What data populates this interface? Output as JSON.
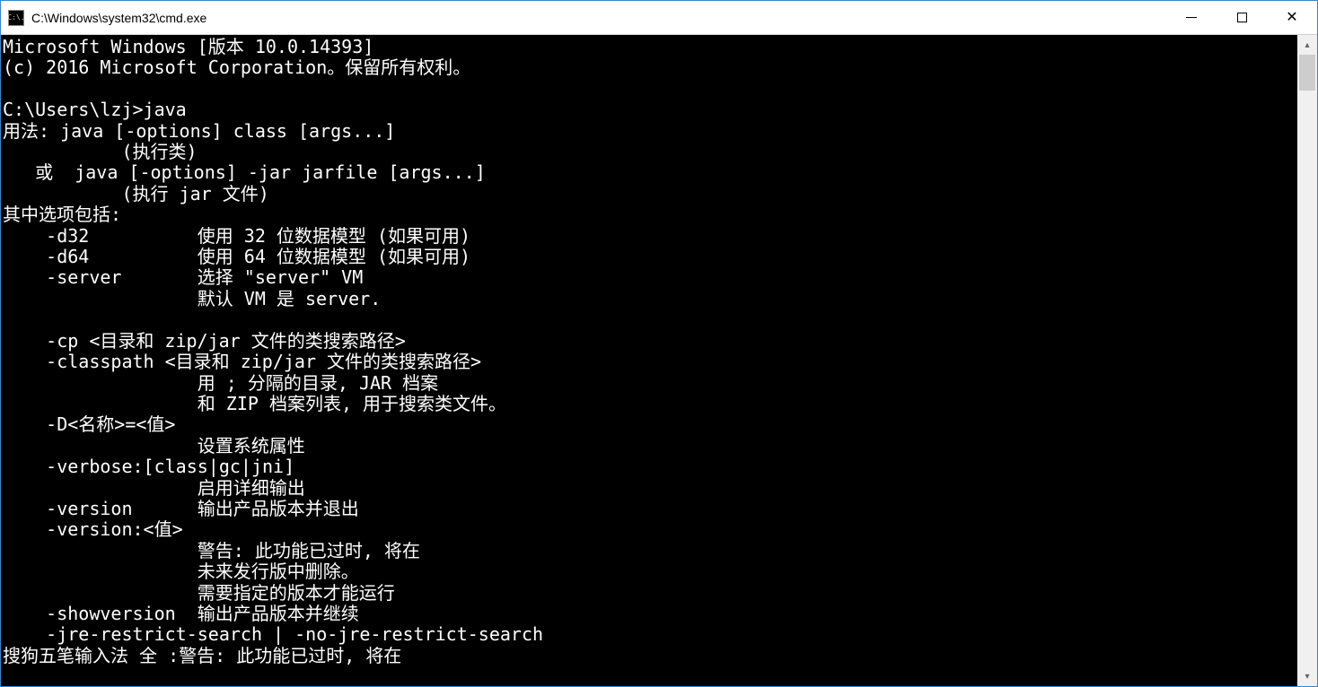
{
  "window": {
    "title": "C:\\Windows\\system32\\cmd.exe",
    "icon_label": "C:\\."
  },
  "terminal": {
    "lines": [
      "Microsoft Windows [版本 10.0.14393]",
      "(c) 2016 Microsoft Corporation。保留所有权利。",
      "",
      "C:\\Users\\lzj>java",
      "用法: java [-options] class [args...]",
      "           (执行类)",
      "   或  java [-options] -jar jarfile [args...]",
      "           (执行 jar 文件)",
      "其中选项包括:",
      "    -d32          使用 32 位数据模型 (如果可用)",
      "    -d64          使用 64 位数据模型 (如果可用)",
      "    -server       选择 \"server\" VM",
      "                  默认 VM 是 server.",
      "",
      "    -cp <目录和 zip/jar 文件的类搜索路径>",
      "    -classpath <目录和 zip/jar 文件的类搜索路径>",
      "                  用 ; 分隔的目录, JAR 档案",
      "                  和 ZIP 档案列表, 用于搜索类文件。",
      "    -D<名称>=<值>",
      "                  设置系统属性",
      "    -verbose:[class|gc|jni]",
      "                  启用详细输出",
      "    -version      输出产品版本并退出",
      "    -version:<值>",
      "                  警告: 此功能已过时, 将在",
      "                  未来发行版中删除。",
      "                  需要指定的版本才能运行",
      "    -showversion  输出产品版本并继续",
      "    -jre-restrict-search | -no-jre-restrict-search",
      "搜狗五笔输入法 全 :警告: 此功能已过时, 将在"
    ]
  }
}
